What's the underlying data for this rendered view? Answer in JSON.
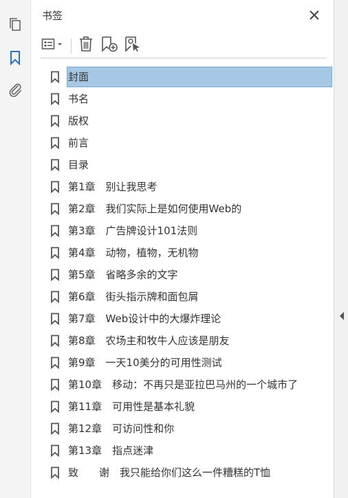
{
  "rail": {
    "pages_icon": "pages-icon",
    "bookmarks_icon": "bookmark-icon",
    "attachments_icon": "paperclip-icon"
  },
  "panel": {
    "title": "书签"
  },
  "toolbar": {
    "options_icon": "options-menu-icon",
    "delete_icon": "trash-icon",
    "new_bookmark_icon": "add-bookmark-icon",
    "bookmark_from_selection_icon": "bookmark-cursor-icon"
  },
  "accent": "#a6c8e4",
  "bookmarks": [
    {
      "label": "封面",
      "selected": true
    },
    {
      "label": "书名"
    },
    {
      "label": "版权"
    },
    {
      "label": "前言"
    },
    {
      "label": "目录"
    },
    {
      "label": "第1章　别让我思考"
    },
    {
      "label": "第2章　我们实际上是如何使用Web的"
    },
    {
      "label": "第3章　广告牌设计101法则"
    },
    {
      "label": "第4章　动物，植物，无机物"
    },
    {
      "label": "第5章　省略多余的文字"
    },
    {
      "label": "第6章　街头指示牌和面包屑"
    },
    {
      "label": "第7章　Web设计中的大爆炸理论"
    },
    {
      "label": "第8章　农场主和牧牛人应该是朋友"
    },
    {
      "label": "第9章　一天10美分的可用性测试"
    },
    {
      "label": "第10章　移动：不再只是亚拉巴马州的一个城市了"
    },
    {
      "label": "第11章　可用性是基本礼貌"
    },
    {
      "label": "第12章　可访问性和你"
    },
    {
      "label": "第13章　指点迷津"
    },
    {
      "label": "致　　谢　我只能给你们这么一件糟糕的T恤"
    }
  ]
}
